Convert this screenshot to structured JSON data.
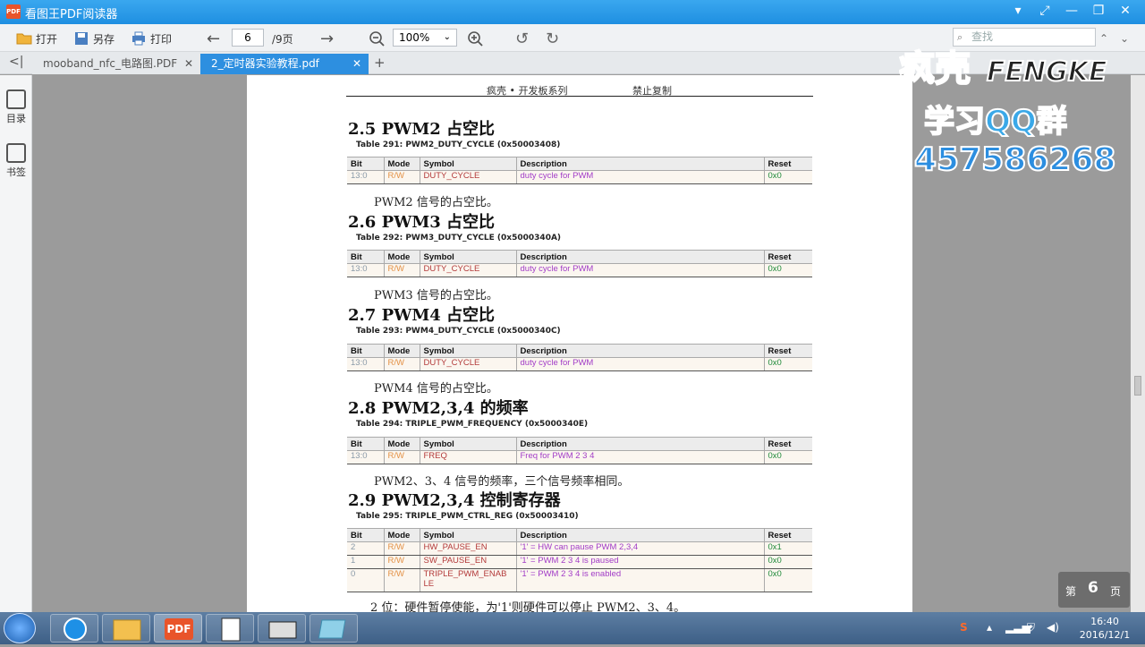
{
  "window": {
    "app_badge": "PDF",
    "title": "看图王PDF阅读器"
  },
  "toolbar": {
    "open_label": "打开",
    "saveas_label": "另存",
    "print_label": "打印",
    "page_current": "6",
    "page_total": "/9页",
    "zoom": "100%",
    "search_placeholder": "查找"
  },
  "tabs": [
    {
      "label": "mooband_nfc_电路图.PDF"
    },
    {
      "label": "2_定时器实验教程.pdf"
    }
  ],
  "sidebar": {
    "toc_label": "目录",
    "bookmark_label": "书签"
  },
  "document": {
    "header_left": "疯壳 • 开发板系列",
    "header_right": "禁止复制",
    "columns": [
      "Bit",
      "Mode",
      "Symbol",
      "Description",
      "Reset"
    ],
    "sections": [
      {
        "title": "2.5 PWM2 占空比",
        "caption": "Table 291: PWM2_DUTY_CYCLE (0x50003408)",
        "rows": [
          {
            "bit": "13:0",
            "mode": "R/W",
            "symbol": "DUTY_CYCLE",
            "desc": "duty cycle for PWM",
            "reset": "0x0"
          }
        ],
        "note": "PWM2 信号的占空比。"
      },
      {
        "title": "2.6 PWM3 占空比",
        "caption": "Table 292: PWM3_DUTY_CYCLE (0x5000340A)",
        "rows": [
          {
            "bit": "13:0",
            "mode": "R/W",
            "symbol": "DUTY_CYCLE",
            "desc": "duty cycle for PWM",
            "reset": "0x0"
          }
        ],
        "note": "PWM3 信号的占空比。"
      },
      {
        "title": "2.7 PWM4 占空比",
        "caption": "Table 293: PWM4_DUTY_CYCLE (0x5000340C)",
        "rows": [
          {
            "bit": "13:0",
            "mode": "R/W",
            "symbol": "DUTY_CYCLE",
            "desc": "duty cycle for PWM",
            "reset": "0x0"
          }
        ],
        "note": "PWM4 信号的占空比。"
      },
      {
        "title": "2.8 PWM2,3,4 的频率",
        "caption": "Table 294: TRIPLE_PWM_FREQUENCY (0x5000340E)",
        "rows": [
          {
            "bit": "13:0",
            "mode": "R/W",
            "symbol": "FREQ",
            "desc": "Freq for PWM 2 3 4",
            "reset": "0x0"
          }
        ],
        "note": "PWM2、3、4 信号的频率，三个信号频率相同。"
      },
      {
        "title": "2.9 PWM2,3,4 控制寄存器",
        "caption": "Table 295: TRIPLE_PWM_CTRL_REG (0x50003410)",
        "rows": [
          {
            "bit": "2",
            "mode": "R/W",
            "symbol": "HW_PAUSE_EN",
            "desc": "'1' = HW can pause PWM 2,3,4",
            "reset": "0x1"
          },
          {
            "bit": "1",
            "mode": "R/W",
            "symbol": "SW_PAUSE_EN",
            "desc": "'1' = PWM 2 3 4 is paused",
            "reset": "0x0"
          },
          {
            "bit": "0",
            "mode": "R/W",
            "symbol": "TRIPLE_PWM_ENAB LE",
            "desc": "'1' = PWM 2 3 4 is enabled",
            "reset": "0x0"
          }
        ],
        "note": "2 位：硬件暂停使能，为'1'则硬件可以停止 PWM2、3、4。"
      }
    ]
  },
  "overlay": {
    "brand": "FENGKE",
    "brand_cn": "疯壳",
    "qq_title": "学习QQ群",
    "qq_number": "457586268"
  },
  "page_badge": {
    "prefix": "第",
    "number": "6",
    "suffix": "页"
  },
  "taskbar": {
    "time": "16:40",
    "date": "2016/12/1",
    "pdf_label": "PDF"
  }
}
